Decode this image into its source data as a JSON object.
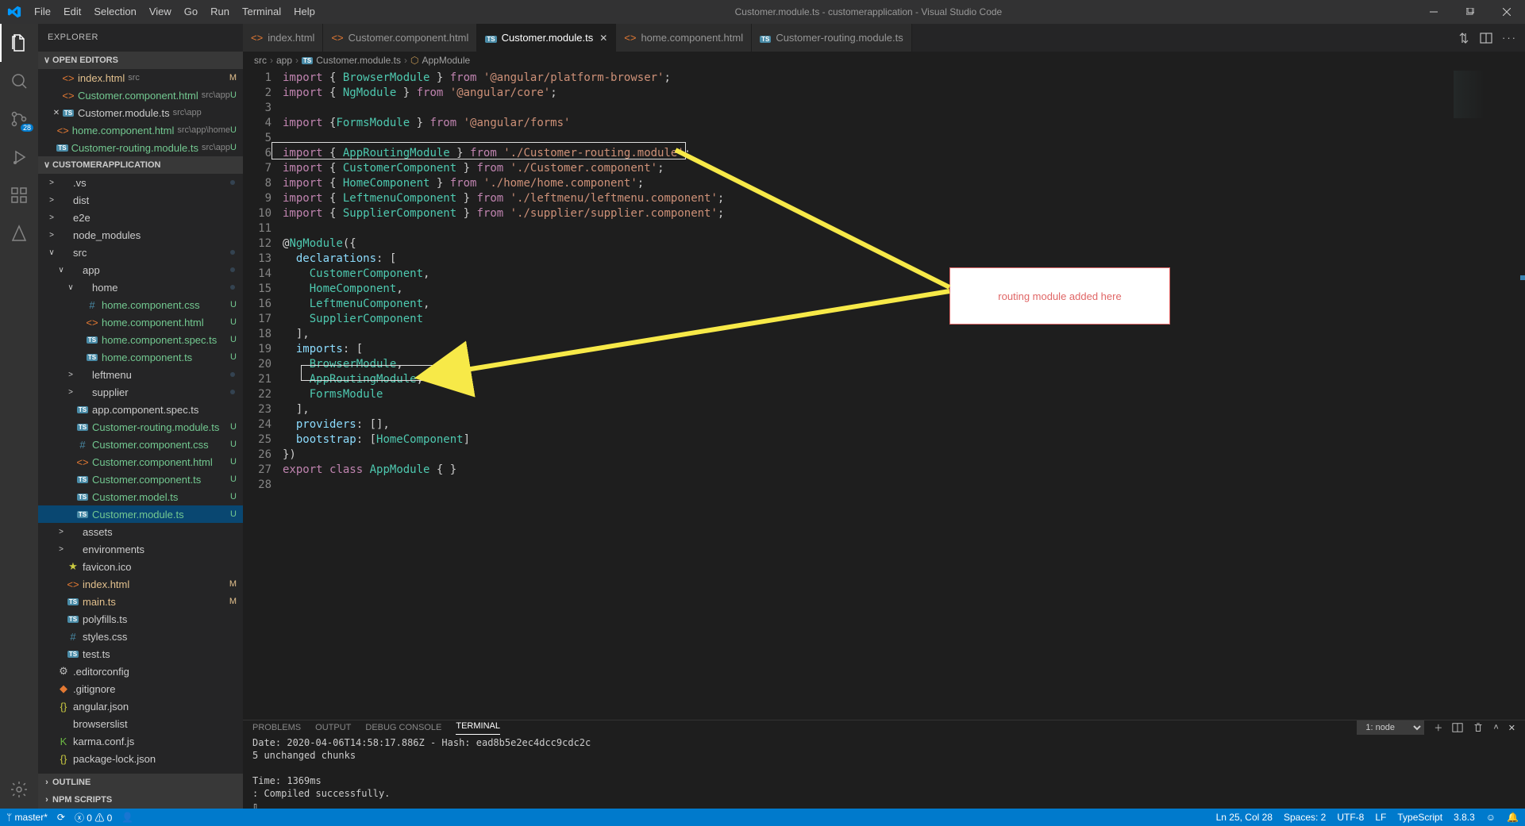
{
  "titlebar": {
    "title": "Customer.module.ts - customerapplication - Visual Studio Code",
    "menu": [
      "File",
      "Edit",
      "Selection",
      "View",
      "Go",
      "Run",
      "Terminal",
      "Help"
    ]
  },
  "activitybar": {
    "source_control_badge": "28"
  },
  "sidebar": {
    "header": "EXPLORER",
    "panes": {
      "open_editors": "OPEN EDITORS",
      "folder": "CUSTOMERAPPLICATION",
      "outline": "OUTLINE",
      "npm": "NPM SCRIPTS"
    },
    "open_editors": [
      {
        "icon": "html",
        "name": "index.html",
        "sub": "src",
        "status": "M",
        "mod": "modified"
      },
      {
        "icon": "html",
        "name": "Customer.component.html",
        "sub": "src\\app",
        "status": "U",
        "mod": "untracked"
      },
      {
        "icon": "ts",
        "name": "Customer.module.ts",
        "sub": "src\\app",
        "status": "",
        "mod": "",
        "active": true
      },
      {
        "icon": "html",
        "name": "home.component.html",
        "sub": "src\\app\\home",
        "status": "U",
        "mod": "untracked"
      },
      {
        "icon": "ts",
        "name": "Customer-routing.module.ts",
        "sub": "src\\app",
        "status": "U",
        "mod": "untracked"
      }
    ],
    "tree": [
      {
        "depth": 0,
        "chev": ">",
        "icon": "",
        "name": ".vs",
        "status": "",
        "dot": true
      },
      {
        "depth": 0,
        "chev": ">",
        "icon": "",
        "name": "dist",
        "status": ""
      },
      {
        "depth": 0,
        "chev": ">",
        "icon": "",
        "name": "e2e",
        "status": ""
      },
      {
        "depth": 0,
        "chev": ">",
        "icon": "",
        "name": "node_modules",
        "status": ""
      },
      {
        "depth": 0,
        "chev": "∨",
        "icon": "",
        "name": "src",
        "status": "",
        "dot": true
      },
      {
        "depth": 1,
        "chev": "∨",
        "icon": "",
        "name": "app",
        "status": "",
        "dot": true
      },
      {
        "depth": 2,
        "chev": "∨",
        "icon": "",
        "name": "home",
        "status": "",
        "dot": true
      },
      {
        "depth": 3,
        "chev": "",
        "icon": "css",
        "name": "home.component.css",
        "status": "U",
        "mod": "untracked"
      },
      {
        "depth": 3,
        "chev": "",
        "icon": "html",
        "name": "home.component.html",
        "status": "U",
        "mod": "untracked"
      },
      {
        "depth": 3,
        "chev": "",
        "icon": "ts",
        "name": "home.component.spec.ts",
        "status": "U",
        "mod": "untracked"
      },
      {
        "depth": 3,
        "chev": "",
        "icon": "ts",
        "name": "home.component.ts",
        "status": "U",
        "mod": "untracked"
      },
      {
        "depth": 2,
        "chev": ">",
        "icon": "",
        "name": "leftmenu",
        "status": "",
        "dot": true
      },
      {
        "depth": 2,
        "chev": ">",
        "icon": "",
        "name": "supplier",
        "status": "",
        "dot": true
      },
      {
        "depth": 2,
        "chev": "",
        "icon": "ts",
        "name": "app.component.spec.ts",
        "status": ""
      },
      {
        "depth": 2,
        "chev": "",
        "icon": "ts",
        "name": "Customer-routing.module.ts",
        "status": "U",
        "mod": "untracked"
      },
      {
        "depth": 2,
        "chev": "",
        "icon": "css",
        "name": "Customer.component.css",
        "status": "U",
        "mod": "untracked"
      },
      {
        "depth": 2,
        "chev": "",
        "icon": "html",
        "name": "Customer.component.html",
        "status": "U",
        "mod": "untracked"
      },
      {
        "depth": 2,
        "chev": "",
        "icon": "ts",
        "name": "Customer.component.ts",
        "status": "U",
        "mod": "untracked"
      },
      {
        "depth": 2,
        "chev": "",
        "icon": "ts",
        "name": "Customer.model.ts",
        "status": "U",
        "mod": "untracked"
      },
      {
        "depth": 2,
        "chev": "",
        "icon": "ts",
        "name": "Customer.module.ts",
        "status": "U",
        "mod": "untracked",
        "selected": true
      },
      {
        "depth": 1,
        "chev": ">",
        "icon": "",
        "name": "assets",
        "status": ""
      },
      {
        "depth": 1,
        "chev": ">",
        "icon": "",
        "name": "environments",
        "status": ""
      },
      {
        "depth": 1,
        "chev": "",
        "icon": "star",
        "name": "favicon.ico",
        "status": ""
      },
      {
        "depth": 1,
        "chev": "",
        "icon": "html",
        "name": "index.html",
        "status": "M",
        "mod": "modified"
      },
      {
        "depth": 1,
        "chev": "",
        "icon": "ts",
        "name": "main.ts",
        "status": "M",
        "mod": "modified"
      },
      {
        "depth": 1,
        "chev": "",
        "icon": "ts",
        "name": "polyfills.ts",
        "status": ""
      },
      {
        "depth": 1,
        "chev": "",
        "icon": "css",
        "name": "styles.css",
        "status": ""
      },
      {
        "depth": 1,
        "chev": "",
        "icon": "ts",
        "name": "test.ts",
        "status": ""
      },
      {
        "depth": 0,
        "chev": "",
        "icon": "gear",
        "name": ".editorconfig",
        "status": ""
      },
      {
        "depth": 0,
        "chev": "",
        "icon": "git",
        "name": ".gitignore",
        "status": ""
      },
      {
        "depth": 0,
        "chev": "",
        "icon": "json",
        "name": "angular.json",
        "status": ""
      },
      {
        "depth": 0,
        "chev": "",
        "icon": "",
        "name": "browserslist",
        "status": ""
      },
      {
        "depth": 0,
        "chev": "",
        "icon": "karma",
        "name": "karma.conf.js",
        "status": ""
      },
      {
        "depth": 0,
        "chev": "",
        "icon": "json",
        "name": "package-lock.json",
        "status": ""
      }
    ]
  },
  "tabs": [
    {
      "icon": "html",
      "label": "index.html"
    },
    {
      "icon": "html",
      "label": "Customer.component.html"
    },
    {
      "icon": "ts",
      "label": "Customer.module.ts",
      "active": true
    },
    {
      "icon": "html",
      "label": "home.component.html"
    },
    {
      "icon": "ts",
      "label": "Customer-routing.module.ts"
    }
  ],
  "breadcrumbs": [
    "src",
    "app",
    "Customer.module.ts",
    "AppModule"
  ],
  "code_lines": [
    "import { BrowserModule } from '@angular/platform-browser';",
    "import { NgModule } from '@angular/core';",
    "",
    "import {FormsModule } from '@angular/forms'",
    "",
    "import { AppRoutingModule } from './Customer-routing.module';",
    "import { CustomerComponent } from './Customer.component';",
    "import { HomeComponent } from './home/home.component';",
    "import { LeftmenuComponent } from './leftmenu/leftmenu.component';",
    "import { SupplierComponent } from './supplier/supplier.component';",
    "",
    "@NgModule({",
    "  declarations: [",
    "    CustomerComponent,",
    "    HomeComponent,",
    "    LeftmenuComponent,",
    "    SupplierComponent",
    "  ],",
    "  imports: [",
    "    BrowserModule,",
    "    AppRoutingModule,",
    "    FormsModule",
    "  ],",
    "  providers: [],",
    "  bootstrap: [HomeComponent]",
    "})",
    "export class AppModule { }",
    ""
  ],
  "annotation": "routing module added here",
  "panel": {
    "tabs": [
      "PROBLEMS",
      "OUTPUT",
      "DEBUG CONSOLE",
      "TERMINAL"
    ],
    "dropdown": "1: node",
    "body": "Date: 2020-04-06T14:58:17.886Z - Hash: ead8b5e2ec4dcc9cdc2c\n5 unchanged chunks\n\nTime: 1369ms\n: Compiled successfully.\n▯"
  },
  "statusbar": {
    "branch": "master*",
    "sync": "",
    "errors": "0",
    "warnings": "0",
    "lncol": "Ln 25, Col 28",
    "spaces": "Spaces: 2",
    "encoding": "UTF-8",
    "eol": "LF",
    "lang": "TypeScript",
    "tsver": "3.8.3",
    "feedback": ""
  }
}
